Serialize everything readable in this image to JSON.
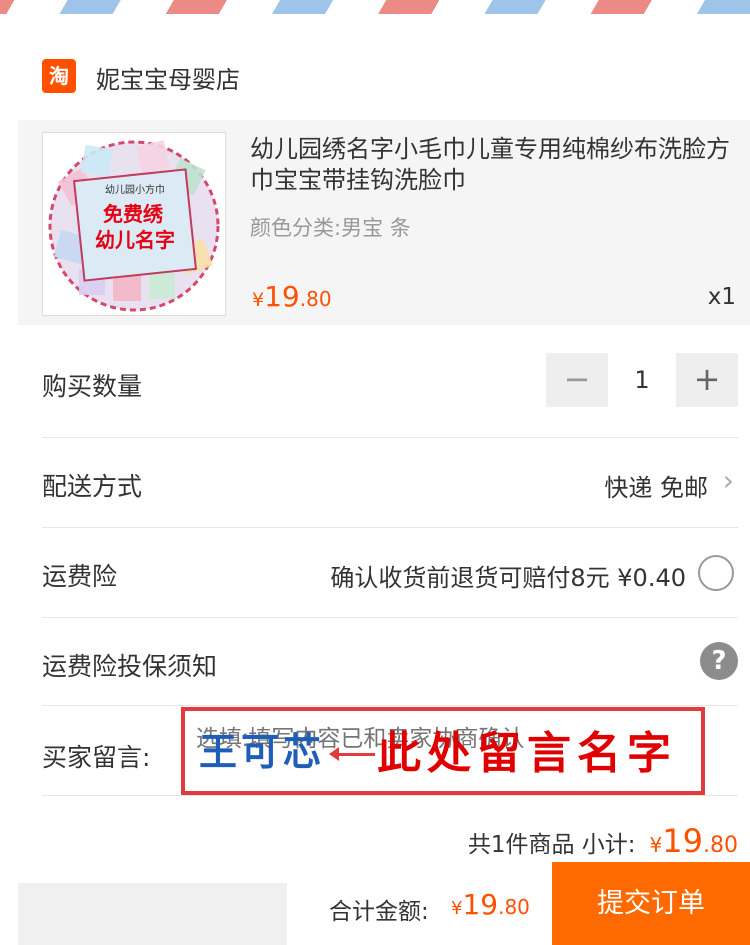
{
  "shop": {
    "logo": "淘",
    "name": "妮宝宝母婴店"
  },
  "item": {
    "title": "幼儿园绣名字小毛巾儿童专用纯棉纱布洗脸方巾宝宝带挂钩洗脸巾",
    "sku": "颜色分类:男宝  条",
    "price_currency": "¥",
    "price_int": "19",
    "price_dec": ".80",
    "qty": "x1",
    "thumb_text": {
      "top": "幼儿园小方巾",
      "line1": "免费绣",
      "line2": "幼儿名字"
    }
  },
  "quantity": {
    "label": "购买数量",
    "minus": "−",
    "value": "1",
    "plus": "+"
  },
  "delivery": {
    "label": "配送方式",
    "value": "快递 免邮"
  },
  "insurance": {
    "label": "运费险",
    "value": "确认收货前退货可赔付8元  ¥0.40"
  },
  "insurance_notice": {
    "label": "运费险投保须知",
    "help": "?"
  },
  "message": {
    "label": "买家留言:",
    "placeholder": "选填:填写内容已和卖家协商确认",
    "annotation_blue": "王可芯",
    "annotation_red": "此处留言名字"
  },
  "subtotal": {
    "label": "共1件商品  小计:",
    "currency": "¥",
    "int": "19",
    "dec": ".80"
  },
  "footer": {
    "total_label": "合计金额:",
    "currency": "¥",
    "int": "19",
    "dec": ".80",
    "submit": "提交订单"
  },
  "colors": {
    "accent": "#ff5000",
    "submit_bg": "#ff6a00",
    "annotation_red": "#e23b3b",
    "annotation_blue": "#1e5eb8"
  }
}
